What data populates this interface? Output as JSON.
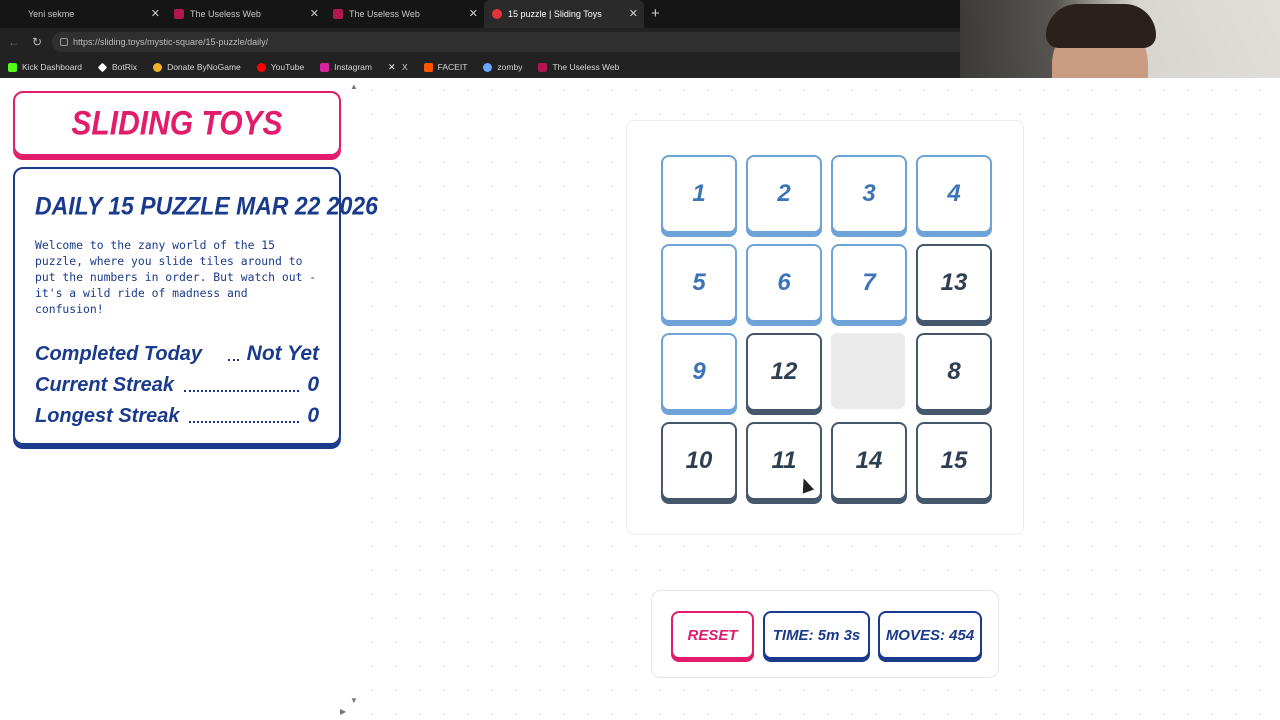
{
  "browser": {
    "tabs": [
      {
        "title": "Yeni sekme"
      },
      {
        "title": "The Useless Web"
      },
      {
        "title": "The Useless Web"
      },
      {
        "title": "15 puzzle | Sliding Toys"
      }
    ],
    "url": "https://sliding.toys/mystic-square/15-puzzle/daily/",
    "bookmarks": [
      {
        "label": "Kick Dashboard",
        "icon": "kick-icon",
        "color": "#53fc18"
      },
      {
        "label": "BotRix",
        "icon": "botrix-icon",
        "color": "#ffffff"
      },
      {
        "label": "Donate ByNoGame",
        "icon": "bynogame-icon",
        "color": "#f0b429"
      },
      {
        "label": "YouTube",
        "icon": "youtube-icon",
        "color": "#ff0000"
      },
      {
        "label": "Instagram",
        "icon": "instagram-icon",
        "color": "#d6249f"
      },
      {
        "label": "X",
        "icon": "x-icon",
        "color": "#ffffff"
      },
      {
        "label": "FACEIT",
        "icon": "faceit-icon",
        "color": "#ff5500"
      },
      {
        "label": "zomby",
        "icon": "zomby-icon",
        "color": "#6aa8ff"
      },
      {
        "label": "The Useless Web",
        "icon": "uselessweb-icon",
        "color": "#b0174f"
      }
    ]
  },
  "site": {
    "logo": "SLIDING TOYS",
    "puzzle_title": "DAILY 15 PUZZLE MAR 22 2026",
    "description": "Welcome to the zany world of the 15 puzzle, where you slide tiles around to put the numbers in order. But watch out - it's a wild ride of madness and confusion!",
    "stats": [
      {
        "label": "Completed Today",
        "value": "Not Yet"
      },
      {
        "label": "Current Streak",
        "value": "0"
      },
      {
        "label": "Longest Streak",
        "value": "0"
      }
    ]
  },
  "board": {
    "grid": [
      [
        "1",
        "2",
        "3",
        "4"
      ],
      [
        "5",
        "6",
        "7",
        "13"
      ],
      [
        "9",
        "12",
        "",
        "8"
      ],
      [
        "10",
        "11",
        "14",
        "15"
      ]
    ],
    "correct": [
      [
        true,
        true,
        true,
        true
      ],
      [
        true,
        true,
        true,
        false
      ],
      [
        true,
        false,
        false,
        false
      ],
      [
        false,
        false,
        false,
        false
      ]
    ]
  },
  "controls": {
    "reset_label": "RESET",
    "time_label": "TIME: 5m 3s",
    "moves_label": "MOVES: 454"
  },
  "colors": {
    "brand_pink": "#e21b6a",
    "brand_blue": "#1a3a8c",
    "tile_correct": "#6ea3d8",
    "tile_incorrect": "#45586b"
  }
}
